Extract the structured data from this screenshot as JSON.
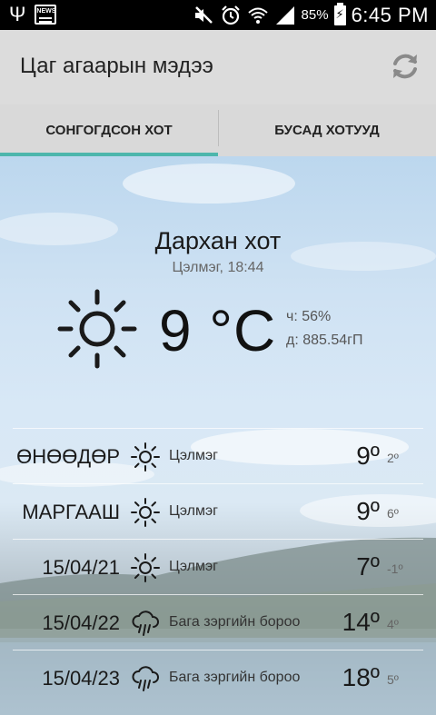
{
  "status_bar": {
    "battery_percent": "85%",
    "time": "6:45 PM",
    "icons": [
      "usb-icon",
      "news-icon",
      "mute-icon",
      "alarm-icon",
      "wifi-icon",
      "signal-icon",
      "battery-charging-icon"
    ]
  },
  "app_bar": {
    "title": "Цаг агаарын мэдээ",
    "refresh_icon": "refresh-icon"
  },
  "tabs": [
    {
      "label": "СОНГОГДСОН ХОТ",
      "active": true
    },
    {
      "label": "БУСАД ХОТУУД",
      "active": false
    }
  ],
  "current": {
    "city": "Дархан хот",
    "updated": "Цэлмэг, 18:44",
    "icon": "sun-icon",
    "temperature": "9 °C",
    "humidity": "ч: 56%",
    "pressure": "д: 885.54гП"
  },
  "forecast": [
    {
      "day": "ӨНӨӨДӨР",
      "icon": "sun-icon",
      "condition": "Цэлмэг",
      "high": "9º",
      "low": "2º"
    },
    {
      "day": "МАРГААШ",
      "icon": "sun-icon",
      "condition": "Цэлмэг",
      "high": "9º",
      "low": "6º"
    },
    {
      "day": "15/04/21",
      "icon": "sun-icon",
      "condition": "Цэлмэг",
      "high": "7º",
      "low": "-1º"
    },
    {
      "day": "15/04/22",
      "icon": "rain-cloud-icon",
      "condition": "Бага зэргийн бороо",
      "high": "14º",
      "low": "4º"
    },
    {
      "day": "15/04/23",
      "icon": "rain-cloud-icon",
      "condition": "Бага зэргийн бороо",
      "high": "18º",
      "low": "5º"
    }
  ],
  "colors": {
    "tab_indicator": "#4db6ac",
    "app_bar_bg": "#dcdcdc",
    "status_bar_bg": "#000000"
  }
}
